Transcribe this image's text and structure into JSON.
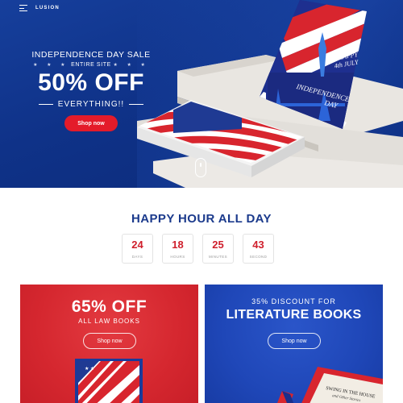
{
  "header": {
    "logo": "LUSION"
  },
  "hero": {
    "title": "INDEPENDENCE DAY SALE",
    "subtitle_stars": "★ ★ ★",
    "subtitle": "ENTIRE SITE",
    "discount": "50% OFF",
    "tagline": "EVERYTHING!!",
    "button_label": "Shop now",
    "book": {
      "line1": "HAPPY",
      "line2": "4th JULY",
      "line3": "INDEPENDENCE",
      "line4": "DAY"
    }
  },
  "countdown": {
    "title": "HAPPY HOUR ALL DAY",
    "items": [
      {
        "value": "24",
        "label": "DAYS"
      },
      {
        "value": "18",
        "label": "HOURS"
      },
      {
        "value": "25",
        "label": "MINUTES"
      },
      {
        "value": "43",
        "label": "SECOND"
      }
    ]
  },
  "promos": {
    "left": {
      "headline": "65% OFF",
      "subline": "ALL LAW BOOKS",
      "button_label": "Shop now"
    },
    "right": {
      "overline": "35% DISCOUNT FOR",
      "headline": "LITERATURE BOOKS",
      "button_label": "Shop now",
      "book_title": "SWING IN THE HOUSE",
      "book_subtitle": "and Other Stories"
    }
  },
  "colors": {
    "brand_red": "#e41b2a",
    "brand_blue": "#0f3288",
    "heading_blue": "#1b3a8c"
  }
}
